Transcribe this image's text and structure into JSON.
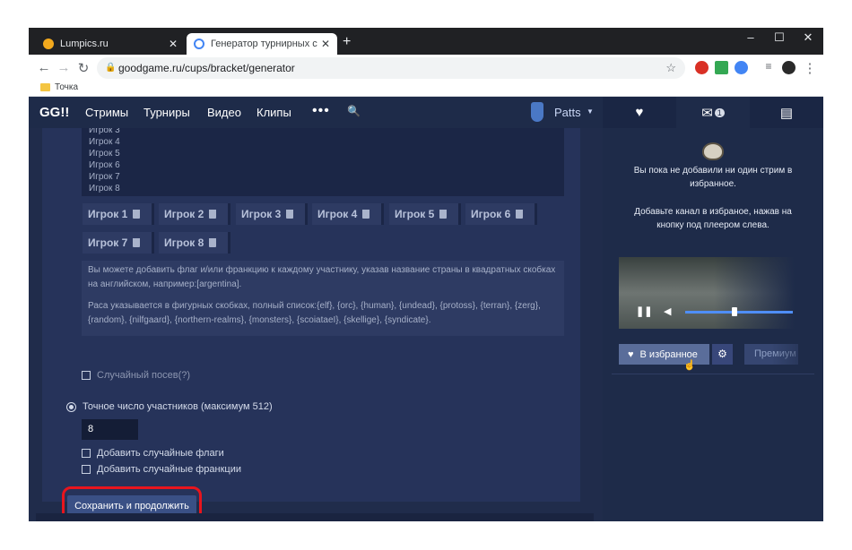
{
  "browser": {
    "tabs": [
      {
        "title": "Lumpics.ru",
        "active": false,
        "favicon_color": "#f2a91d"
      },
      {
        "title": "Генератор турнирных сеток — ",
        "active": true,
        "favicon_color": "#4285f4"
      }
    ],
    "window_controls": {
      "minimize": "–",
      "maximize": "☐",
      "close": "✕"
    },
    "address": "goodgame.ru/cups/bracket/generator",
    "bookmark": "Точка"
  },
  "site": {
    "logo": "GG!!",
    "nav": [
      "Стримы",
      "Турниры",
      "Видео",
      "Клипы"
    ],
    "user": "Patts",
    "side_tabs": {
      "mail_count": "1"
    }
  },
  "form": {
    "players_list": [
      "Игрок 3",
      "Игрок 4",
      "Игрок 5",
      "Игрок 6",
      "Игрок 7",
      "Игрок 8"
    ],
    "chips": [
      "Игрок 1",
      "Игрок 2",
      "Игрок 3",
      "Игрок 4",
      "Игрок 5",
      "Игрок 6",
      "Игрок 7",
      "Игрок 8"
    ],
    "info_flag": "Вы можете добавить флаг и/или франкцию к каждому участнику, указав название страны в квадратных скобках на английском, например:[argentina].",
    "info_race": "Раса указывается в фигурных скобках, полный список:{elf}, {orc}, {human}, {undead}, {protoss}, {terran}, {zerg}, {random}, {nilfgaard}, {northern-realms}, {monsters}, {scoiataeI}, {skellige}, {syndicate}.",
    "random_seed_label": "Случайный посев(?)",
    "exact_count_label": "Точное число участников (максимум 512)",
    "participants_value": "8",
    "random_flags_label": "Добавить случайные флаги",
    "random_franchises_label": "Добавить случайные франкции",
    "save_label": "Сохранить и продолжить"
  },
  "sidebar": {
    "empty_line1": "Вы пока не добавили ни один стрим в избранное.",
    "empty_line2": "Добавьте канал в избраное, нажав на кнопку под плеером слева.",
    "fav_label": "В избранное",
    "premium_label": "Премиум"
  }
}
